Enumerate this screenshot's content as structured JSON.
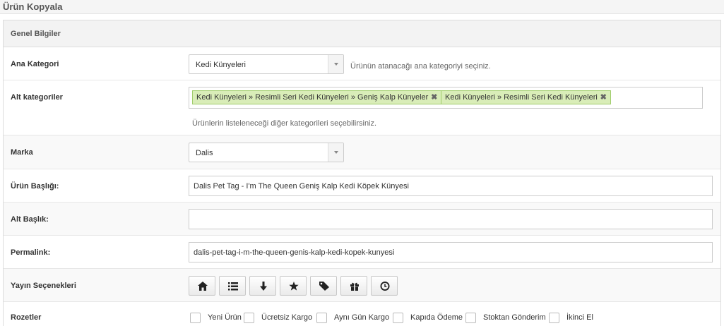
{
  "page": {
    "title": "Ürün Kopyala"
  },
  "panel": {
    "title": "Genel Bilgiler"
  },
  "ana_kategori": {
    "label": "Ana Kategori",
    "value": "Kedi Künyeleri",
    "hint": "Ürünün atanacağı ana kategoriyi seçiniz."
  },
  "alt_kategoriler": {
    "label": "Alt kategoriler",
    "tags": [
      "Kedi Künyeleri » Resimli Seri Kedi Künyeleri » Geniş Kalp Künyeler",
      "Kedi Künyeleri » Resimli Seri Kedi Künyeleri"
    ],
    "remove_glyph": "✖",
    "hint": "Ürünlerin listeleneceği diğer kategorileri seçebilirsiniz."
  },
  "marka": {
    "label": "Marka",
    "value": "Dalis"
  },
  "urun_basligi": {
    "label": "Ürün Başlığı:",
    "value": "Dalis Pet Tag - I'm The Queen Geniş Kalp Kedi Köpek Künyesi"
  },
  "alt_baslik": {
    "label": "Alt Başlık:",
    "value": ""
  },
  "permalink": {
    "label": "Permalink:",
    "value": "dalis-pet-tag-i-m-the-queen-genis-kalp-kedi-kopek-kunyesi"
  },
  "yayin": {
    "label": "Yayın Seçenekleri",
    "buttons": [
      "home-icon",
      "list-icon",
      "arrow-down-icon",
      "star-icon",
      "tag-icon",
      "gift-icon",
      "clock-icon"
    ]
  },
  "rozetler": {
    "label": "Rozetler",
    "options": [
      "Yeni Ürün",
      "Ücretsiz Kargo",
      "Aynı Gün Kargo",
      "Kapıda Ödeme",
      "Stoktan Gönderim",
      "İkinci El"
    ]
  },
  "colors": {
    "tag_bg": "#d9edb8",
    "tag_border": "#9fcc6b",
    "header_bg": "#f3f3f3"
  }
}
